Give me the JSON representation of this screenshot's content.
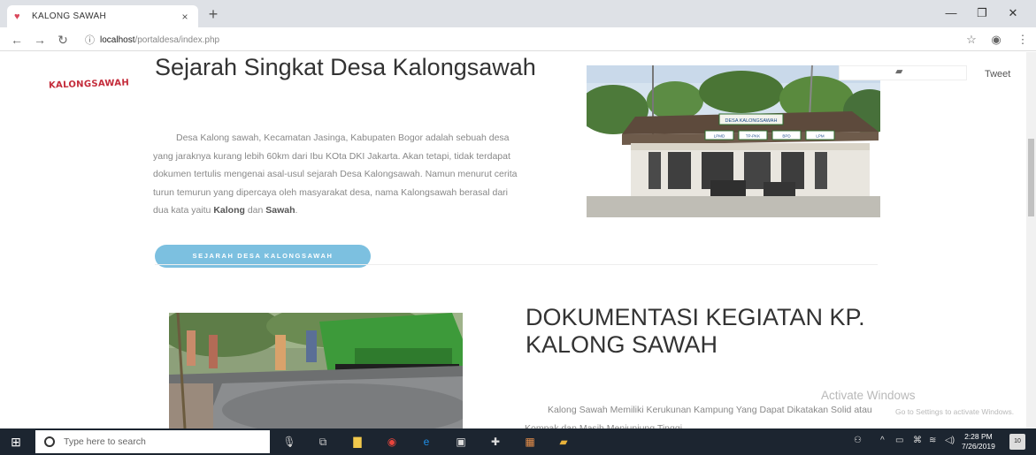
{
  "browser": {
    "tab_title": "KALONG SAWAH",
    "tab_close": "×",
    "new_tab": "+",
    "url_host": "localhost",
    "url_path": "/portaldesa/index.php",
    "info_icon": "ⓘ"
  },
  "page": {
    "logo_text": "KALONGSAWAH",
    "heading1": "Sejarah Singkat Desa Kalongsawah",
    "para1_text": "Desa Kalong sawah, Kecamatan Jasinga, Kabupaten Bogor adalah sebuah desa yang jaraknya kurang lebih 60km dari Ibu KOta DKI Jakarta. Akan tetapi, tidak terdapat dokumen tertulis mengenai asal-usul sejarah Desa Kalongsawah. Namun menurut cerita turun temurun yang dipercaya oleh masyarakat desa, nama Kalongsawah berasal dari dua kata yaitu",
    "para1_bold1": "Kalong",
    "para1_and": "dan",
    "para1_bold2": "Sawah",
    "para1_end": ".",
    "button_label": "SEJARAH DESA KALONGSAWAH",
    "tweet_label": "Tweet",
    "heading2": "DOKUMENTASI KEGIATAN KP. KALONG SAWAH",
    "para2": "Kalong Sawah Memiliki Kerukunan Kampung Yang Dapat Dikatakan Solid atau Kompak dan Masih Menjunjung Tinggi",
    "office_sign": "DESA KALONGSAWAH",
    "office_boards": [
      "LPMD",
      "TP-PKK",
      "BPD",
      "LPM"
    ]
  },
  "watermark": {
    "line1": "Activate Windows",
    "line2": "Go to Settings to activate Windows."
  },
  "taskbar": {
    "search_placeholder": "Type here to search",
    "time": "2:28 PM",
    "date": "7/26/2019",
    "notification_count": "10"
  },
  "colors": {
    "button": "#7cc0e0",
    "logo": "#c42b3a",
    "taskbar": "#1c2530"
  }
}
